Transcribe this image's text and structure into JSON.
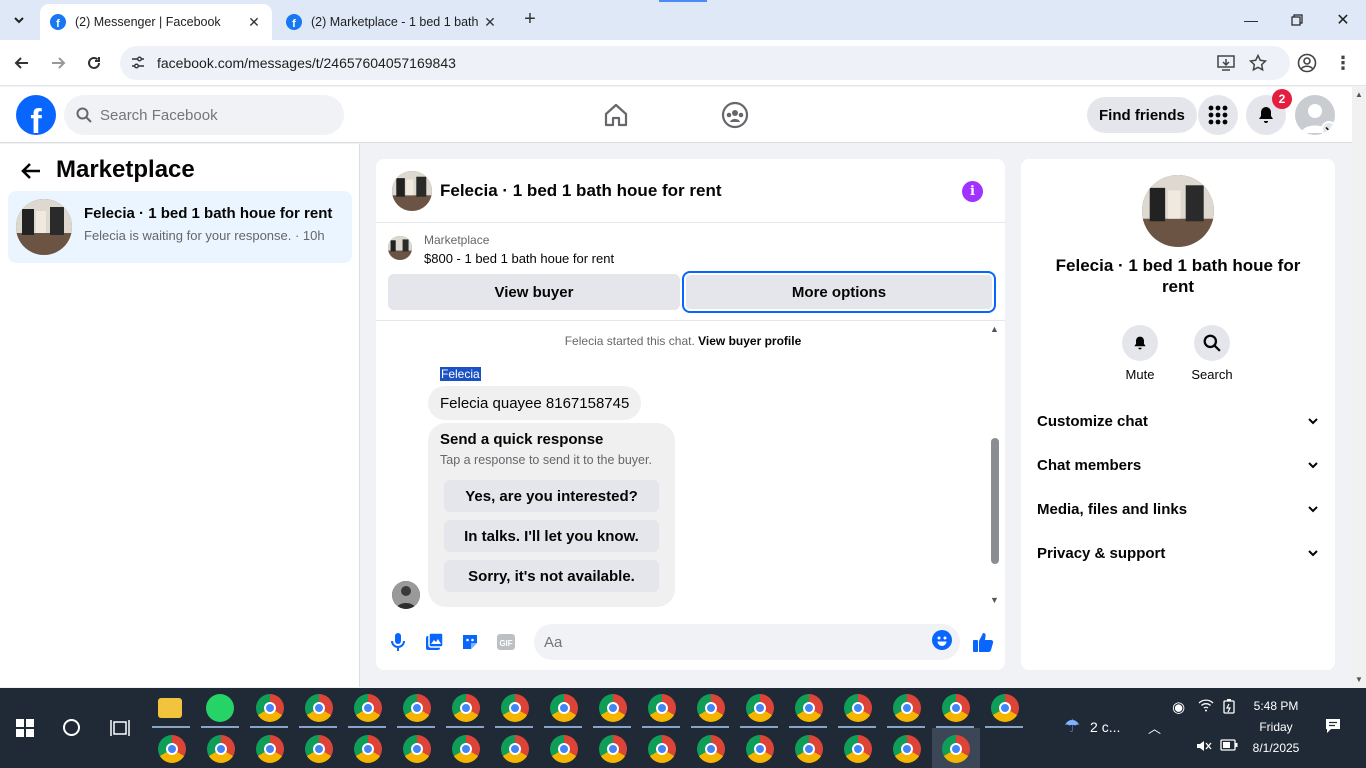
{
  "browser": {
    "tabs": [
      {
        "title": "(2) Messenger | Facebook",
        "active": true
      },
      {
        "title": "(2) Marketplace - 1 bed 1 bath h",
        "active": false
      }
    ],
    "url": "facebook.com/messages/t/24657604057169843"
  },
  "fb_header": {
    "search_placeholder": "Search Facebook",
    "find_friends": "Find friends",
    "notification_count": "2"
  },
  "sidebar": {
    "title": "Marketplace",
    "conversation": {
      "title": "Felecia · 1 bed 1 bath houe for rent",
      "subtitle": "Felecia is waiting for your response. · 10h"
    }
  },
  "chat": {
    "header_name": "Felecia · 1 bed 1 bath houe for rent",
    "listing_label": "Marketplace",
    "listing_price_title": "$800 - 1 bed 1 bath houe for rent",
    "view_buyer": "View buyer",
    "more_options": "More options",
    "started_text": "Felecia started this chat.",
    "view_profile": "View buyer profile",
    "sender_name": "Felecia",
    "message_text": "Felecia quayee 8167158745",
    "quick_title": "Send a quick response",
    "quick_subtitle": "Tap a response to send it to the buyer.",
    "quick_replies": [
      "Yes, are you interested?",
      "In talks. I'll let you know.",
      "Sorry, it's not available."
    ],
    "composer_placeholder": "Aa"
  },
  "right_panel": {
    "name": "Felecia · 1 bed 1 bath houe for rent",
    "actions": [
      "Mute",
      "Search"
    ],
    "sections": [
      "Customize chat",
      "Chat members",
      "Media, files and links",
      "Privacy & support"
    ]
  },
  "taskbar": {
    "weather": "2 c...",
    "time": "5:48 PM",
    "day": "Friday",
    "date": "8/1/2025"
  },
  "colors": {
    "fb_blue": "#0866ff",
    "selected_conv": "#ebf5ff",
    "badge_red": "#e41e3f",
    "info_purple": "#a033ff"
  }
}
